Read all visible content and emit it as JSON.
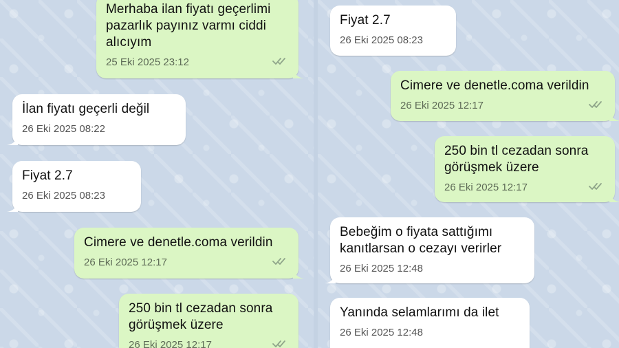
{
  "left_panel": {
    "messages": [
      {
        "direction": "out",
        "text": "Merhaba ilan fiyatı geçerlimi pazarlık payınız varmı ciddi alıcıyım",
        "time": "25 Eki 2025 23:12",
        "status": "read"
      },
      {
        "direction": "in",
        "text": "İlan fiyatı geçerli değil",
        "time": "26 Eki 2025 08:22"
      },
      {
        "direction": "in",
        "text": "Fiyat 2.7",
        "time": "26 Eki 2025 08:23"
      },
      {
        "direction": "out",
        "text": "Cimere ve denetle.coma verildin",
        "time": "26 Eki 2025 12:17",
        "status": "read"
      },
      {
        "direction": "out",
        "text": "250 bin tl cezadan sonra görüşmek üzere",
        "time": "26 Eki 2025 12:17",
        "status": "read"
      }
    ]
  },
  "right_panel": {
    "messages": [
      {
        "direction": "in",
        "text": "Fiyat 2.7",
        "time": "26 Eki 2025 08:23"
      },
      {
        "direction": "out",
        "text": "Cimere ve denetle.coma verildin",
        "time": "26 Eki 2025 12:17",
        "status": "read"
      },
      {
        "direction": "out",
        "text": "250 bin tl cezadan sonra görüşmek üzere",
        "time": "26 Eki 2025 12:17",
        "status": "read"
      },
      {
        "direction": "in",
        "text": "Bebeğim o fiyata sattığımı kanıtlarsan o cezayı verirler",
        "time": "26 Eki 2025 12:48"
      },
      {
        "direction": "in",
        "text": "Yanında selamlarımı da ilet",
        "time": "26 Eki 2025 12:48"
      }
    ]
  },
  "colors": {
    "chat_background": "#cbd8e8",
    "incoming_bubble": "#ffffff",
    "outgoing_bubble": "#dbf6c4",
    "read_ticks": "#8fa58a"
  },
  "icons": {
    "read_status": "double-check-icon"
  }
}
